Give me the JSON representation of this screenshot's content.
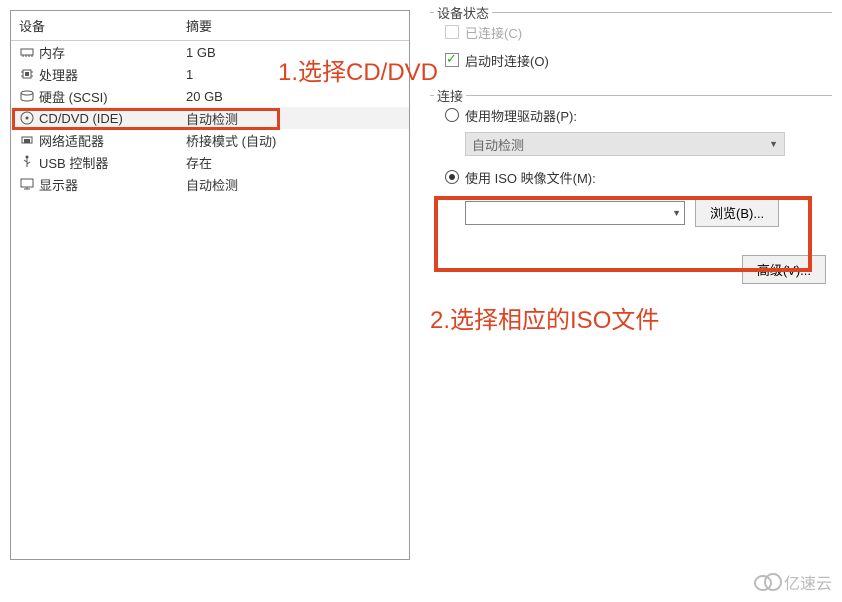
{
  "columns": {
    "device": "设备",
    "summary": "摘要"
  },
  "devices": [
    {
      "icon": "memory-icon",
      "name": "内存",
      "summary": "1 GB"
    },
    {
      "icon": "cpu-icon",
      "name": "处理器",
      "summary": "1"
    },
    {
      "icon": "disk-icon",
      "name": "硬盘 (SCSI)",
      "summary": "20 GB"
    },
    {
      "icon": "cd-icon",
      "name": "CD/DVD (IDE)",
      "summary": "自动检测"
    },
    {
      "icon": "network-icon",
      "name": "网络适配器",
      "summary": "桥接模式 (自动)"
    },
    {
      "icon": "usb-icon",
      "name": "USB 控制器",
      "summary": "存在"
    },
    {
      "icon": "display-icon",
      "name": "显示器",
      "summary": "自动检测"
    }
  ],
  "status": {
    "legend": "设备状态",
    "connected": "已连接(C)",
    "connect_at_power_on": "启动时连接(O)"
  },
  "connection": {
    "legend": "连接",
    "physical": "使用物理驱动器(P):",
    "physical_value": "自动检测",
    "iso": "使用 ISO 映像文件(M):",
    "iso_value": "",
    "browse": "浏览(B)..."
  },
  "advanced": "高级(V)...",
  "annotations": {
    "step1": "1.选择CD/DVD",
    "step2": "2.选择相应的ISO文件"
  },
  "watermark": "亿速云"
}
